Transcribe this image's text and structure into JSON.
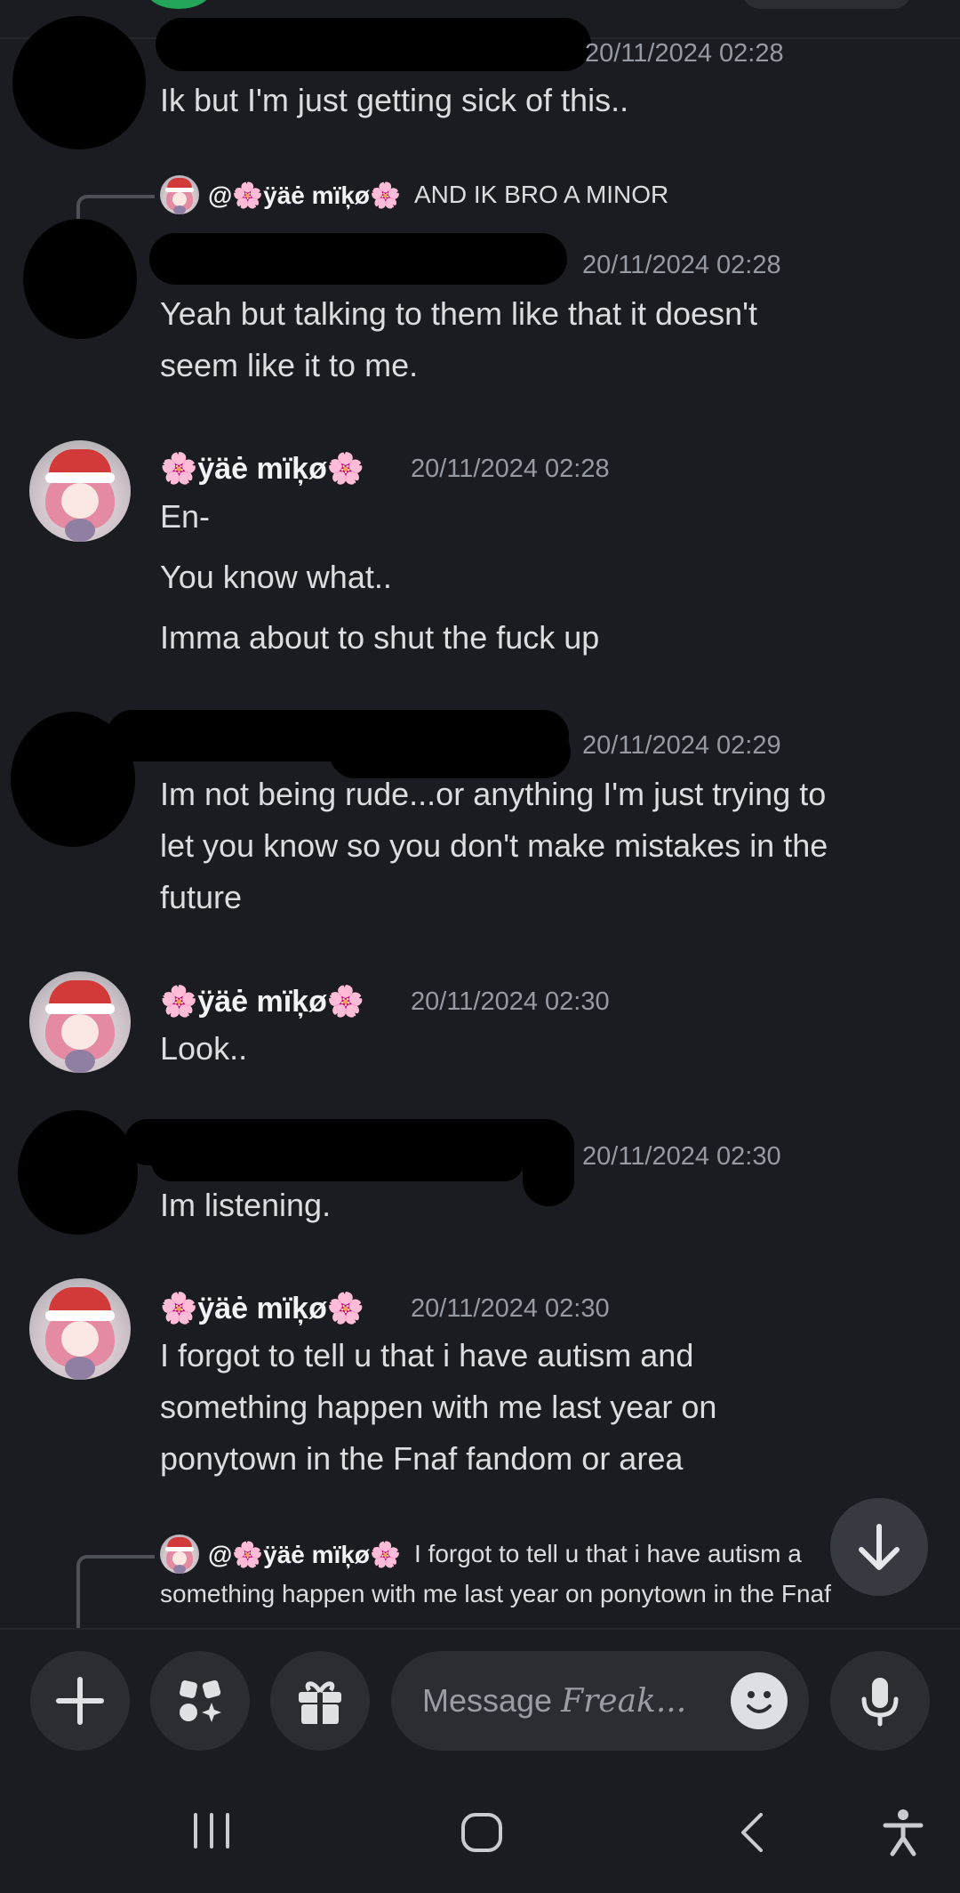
{
  "username_self": "🌸ÿäė mïķø🌸",
  "reply_mention_prefix": "@🌸ÿäė mïķø🌸",
  "messages": [
    {
      "timestamp": "20/11/2024 02:28",
      "lines": [
        "Ik but I'm just getting sick of this.."
      ]
    },
    {
      "reply_text": "AND IK BRO A MINOR",
      "timestamp": "20/11/2024 02:28",
      "lines": [
        "Yeah but talking to them like that it doesn't",
        "seem like it to me."
      ]
    },
    {
      "timestamp": "20/11/2024 02:28",
      "lines": [
        "En-",
        "You know what..",
        "Imma about to shut the fuck up"
      ]
    },
    {
      "timestamp": "20/11/2024 02:29",
      "lines": [
        "Im not being rude...or anything I'm just trying to",
        "let you know so you don't make mistakes in the",
        "future"
      ]
    },
    {
      "timestamp": "20/11/2024 02:30",
      "lines": [
        "Look.."
      ]
    },
    {
      "timestamp": "20/11/2024 02:30",
      "lines": [
        "Im listening."
      ]
    },
    {
      "timestamp": "20/11/2024 02:30",
      "lines": [
        "I forgot to tell u that i have autism and",
        "something happen with me last year on",
        "ponytown in the Fnaf fandom or area"
      ]
    }
  ],
  "bottom_reply": {
    "line1": "I forgot to tell u that i have autism a",
    "line2": "something happen with me last year on ponytown in the Fnaf"
  },
  "composer": {
    "placeholder_prefix": "Message",
    "placeholder_channel": "Freak..."
  },
  "icons": {
    "add": "plus-icon",
    "apps": "apps-icon",
    "gift": "gift-icon",
    "emoji": "emoji-icon",
    "mic": "microphone-icon",
    "scroll": "arrow-down-icon",
    "nav_recents": "recents-icon",
    "nav_home": "home-icon",
    "nav_back": "back-icon",
    "nav_accessibility": "accessibility-icon"
  },
  "colors": {
    "background": "#1b1c21",
    "text": "#dbdee1",
    "timestamp": "#969aa3",
    "button": "#2b2d33"
  }
}
